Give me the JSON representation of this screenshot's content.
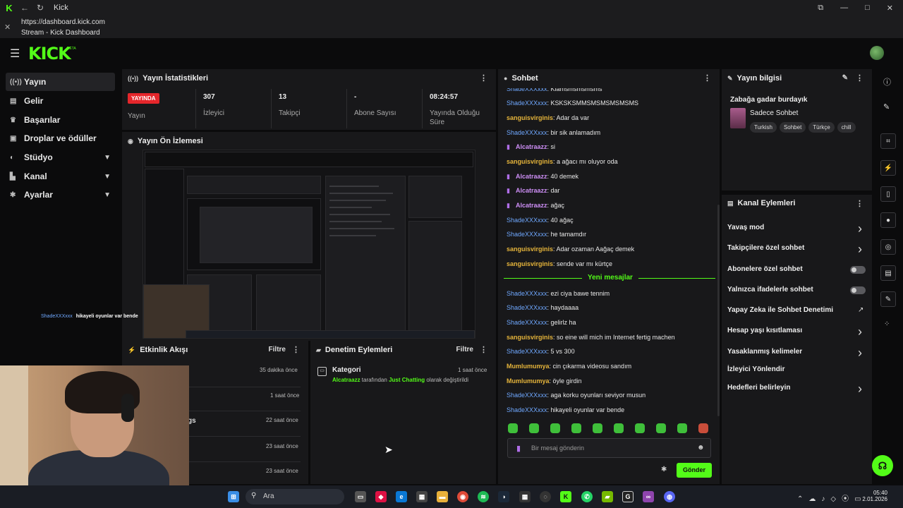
{
  "window": {
    "title": "Kick",
    "logo": "K"
  },
  "browser": {
    "url": "https://dashboard.kick.com",
    "page_title": "Stream - Kick Dashboard"
  },
  "app": {
    "brand": "KICK",
    "beta": "BETA"
  },
  "sidebar": {
    "items": [
      {
        "label": "Yayın",
        "icon": "broadcast-icon"
      },
      {
        "label": "Gelir",
        "icon": "revenue-icon"
      },
      {
        "label": "Başarılar",
        "icon": "trophy-icon"
      },
      {
        "label": "Droplar ve ödüller",
        "icon": "gift-icon"
      },
      {
        "label": "Stüdyo",
        "icon": "studio-icon"
      },
      {
        "label": "Kanal",
        "icon": "channel-icon"
      },
      {
        "label": "Ayarlar",
        "icon": "settings-icon"
      }
    ]
  },
  "stats": {
    "title": "Yayın İstatistikleri",
    "live": "YAYINDA",
    "live_label": "Yayın",
    "viewers": "307",
    "viewers_label": "İzleyici",
    "followers": "13",
    "followers_label": "Takipçi",
    "subs": "-",
    "subs_label": "Abone Sayısı",
    "uptime": "08:24:57",
    "uptime_label": "Yayında Olduğu Süre"
  },
  "preview": {
    "title": "Yayın Ön İzlemesi",
    "overlay_user": "ShadeXXXxxx",
    "overlay_text": "hikayeli oyunlar var bende"
  },
  "activity": {
    "title": "Etkinlik Akışı",
    "filter": "Filtre",
    "times": [
      "35 dakika önce",
      "1 saat önce",
      "22 saat önce",
      "23 saat önce",
      "23 saat önce"
    ],
    "partial": "gs"
  },
  "moderation": {
    "title": "Denetim Eylemleri",
    "filter": "Filtre",
    "item_title": "Kategori",
    "item_time": "1 saat önce",
    "item_user": "Alcatraazz",
    "item_mid": " tarafından ",
    "item_cat": "Just Chatting",
    "item_end": " olarak değiştirildi"
  },
  "chat": {
    "title": "Sohbet",
    "messages": [
      {
        "user": "ShadeXXXxxx",
        "text": ": Klamsmsmsmsms",
        "c": "blue"
      },
      {
        "user": "ShadeXXXxxx",
        "text": ": KSKSKSMMSMSMSMSMSMS",
        "c": "blue"
      },
      {
        "user": "sanguisvirginis",
        "text": ": Adar da var",
        "c": "yel"
      },
      {
        "user": "ShadeXXXxxx",
        "text": ": bir sik anlamadım",
        "c": "blue"
      },
      {
        "user": "Alcatraazz",
        "text": ": si",
        "c": "pur"
      },
      {
        "user": "sanguisvirginis",
        "text": ": a ağacı mı oluyor oda",
        "c": "yel"
      },
      {
        "user": "Alcatraazz",
        "text": ": 40 demek",
        "c": "pur"
      },
      {
        "user": "Alcatraazz",
        "text": ": dar",
        "c": "pur"
      },
      {
        "user": "Alcatraazz",
        "text": ": ağaç",
        "c": "pur"
      },
      {
        "user": "ShadeXXXxxx",
        "text": ": 40 ağaç",
        "c": "blue"
      },
      {
        "user": "ShadeXXXxxx",
        "text": ": he tamamdır",
        "c": "blue"
      },
      {
        "user": "sanguisvirginis",
        "text": ": Adar ozaman Aağaç demek",
        "c": "yel"
      },
      {
        "user": "sanguisvirginis",
        "text": ": sende var mı kürtçe",
        "c": "yel"
      },
      {
        "user": "ShadeXXXxxx",
        "text": ": ezi ciya bawe tennim",
        "c": "blue"
      },
      {
        "user": "ShadeXXXxxx",
        "text": ": haydaaaa",
        "c": "blue"
      },
      {
        "user": "ShadeXXXxxx",
        "text": ": gelirlz ha",
        "c": "blue"
      },
      {
        "user": "sanguisvirginis",
        "text": ": so eine will mich im Internet fertig machen",
        "c": "yel"
      },
      {
        "user": "ShadeXXXxxx",
        "text": ": 5 vs 300",
        "c": "blue"
      },
      {
        "user": "Mumlumumya",
        "text": ": cin çıkarma videosu sandım",
        "c": "yel"
      },
      {
        "user": "Mumlumumya",
        "text": ": öyle girdin",
        "c": "yel"
      },
      {
        "user": "ShadeXXXxxx",
        "text": ": aga korku oyunları seviyor musun",
        "c": "blue"
      },
      {
        "user": "ShadeXXXxxx",
        "text": ": hikayeli oyunlar var bende",
        "c": "blue"
      }
    ],
    "new_messages": "Yeni mesajlar",
    "placeholder": "Bir mesaj gönderin",
    "send": "Gönder"
  },
  "stream_info": {
    "title": "Yayın bilgisi",
    "stream_title": "Zabağa gadar burdayık",
    "category": "Sadece Sohbet",
    "tags": [
      "Turkish",
      "Sohbet",
      "Türkçe",
      "chill"
    ]
  },
  "channel_actions": {
    "title": "Kanal Eylemleri",
    "items": [
      {
        "label": "Yavaş mod",
        "kind": "chevron"
      },
      {
        "label": "Takipçilere özel sohbet",
        "kind": "chevron"
      },
      {
        "label": "Abonelere özel sohbet",
        "kind": "toggle"
      },
      {
        "label": "Yalnızca ifadelerle sohbet",
        "kind": "toggle"
      },
      {
        "label": "Yapay Zeka ile Sohbet Denetimi",
        "kind": "external"
      },
      {
        "label": "Hesap yaşı kısıtlaması",
        "kind": "chevron"
      },
      {
        "label": "Yasaklanmış kelimeler",
        "kind": "chevron"
      },
      {
        "label": "İzleyici Yönlendir",
        "kind": "none"
      },
      {
        "label": "Hedefleri belirleyin",
        "kind": "chevron"
      }
    ]
  },
  "taskbar": {
    "search": "Ara",
    "time": "05:40",
    "date": "2.01.2026"
  }
}
